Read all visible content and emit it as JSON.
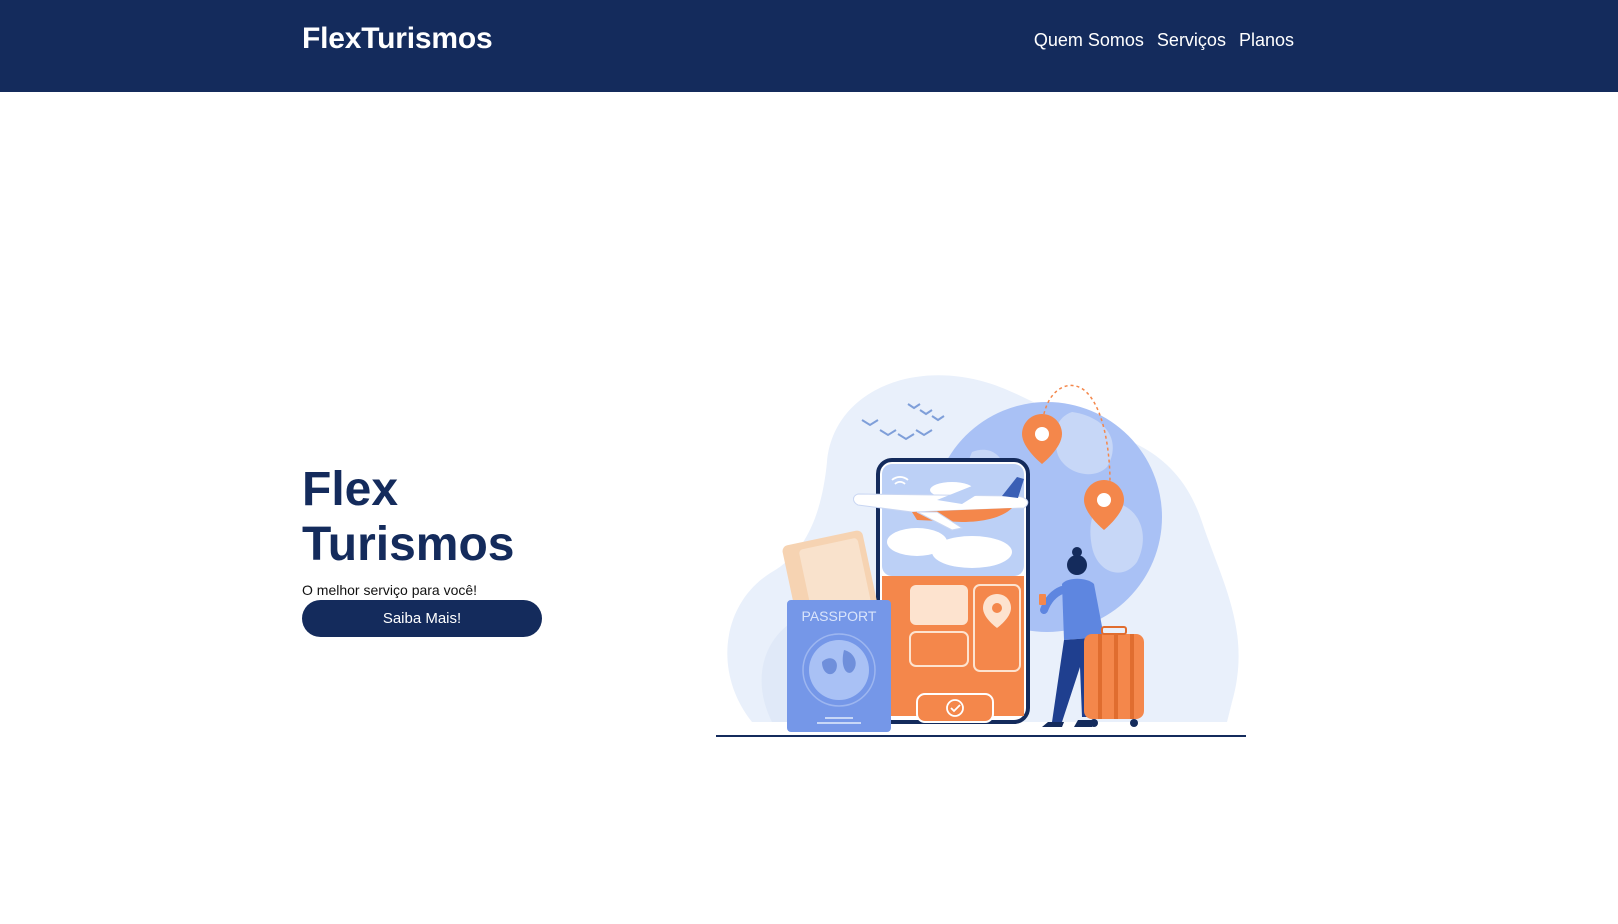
{
  "header": {
    "brand": "FlexTurismos",
    "nav": [
      {
        "label": "Quem Somos"
      },
      {
        "label": "Serviços"
      },
      {
        "label": "Planos"
      }
    ]
  },
  "hero": {
    "title_line1": "Flex",
    "title_line2": "Turismos",
    "subtitle": "O melhor serviço para você!",
    "button_label": "Saiba Mais!"
  },
  "illustration": {
    "passport_label": "PASSPORT",
    "icons": [
      "airplane-icon",
      "location-pin-icon",
      "wifi-icon",
      "checkmark-icon",
      "globe-icon",
      "suitcase-icon"
    ]
  },
  "colors": {
    "primary": "#142b5c",
    "accent_orange": "#f4874b",
    "accent_blue": "#6a8ee8",
    "light_blue": "#e6eefa"
  }
}
